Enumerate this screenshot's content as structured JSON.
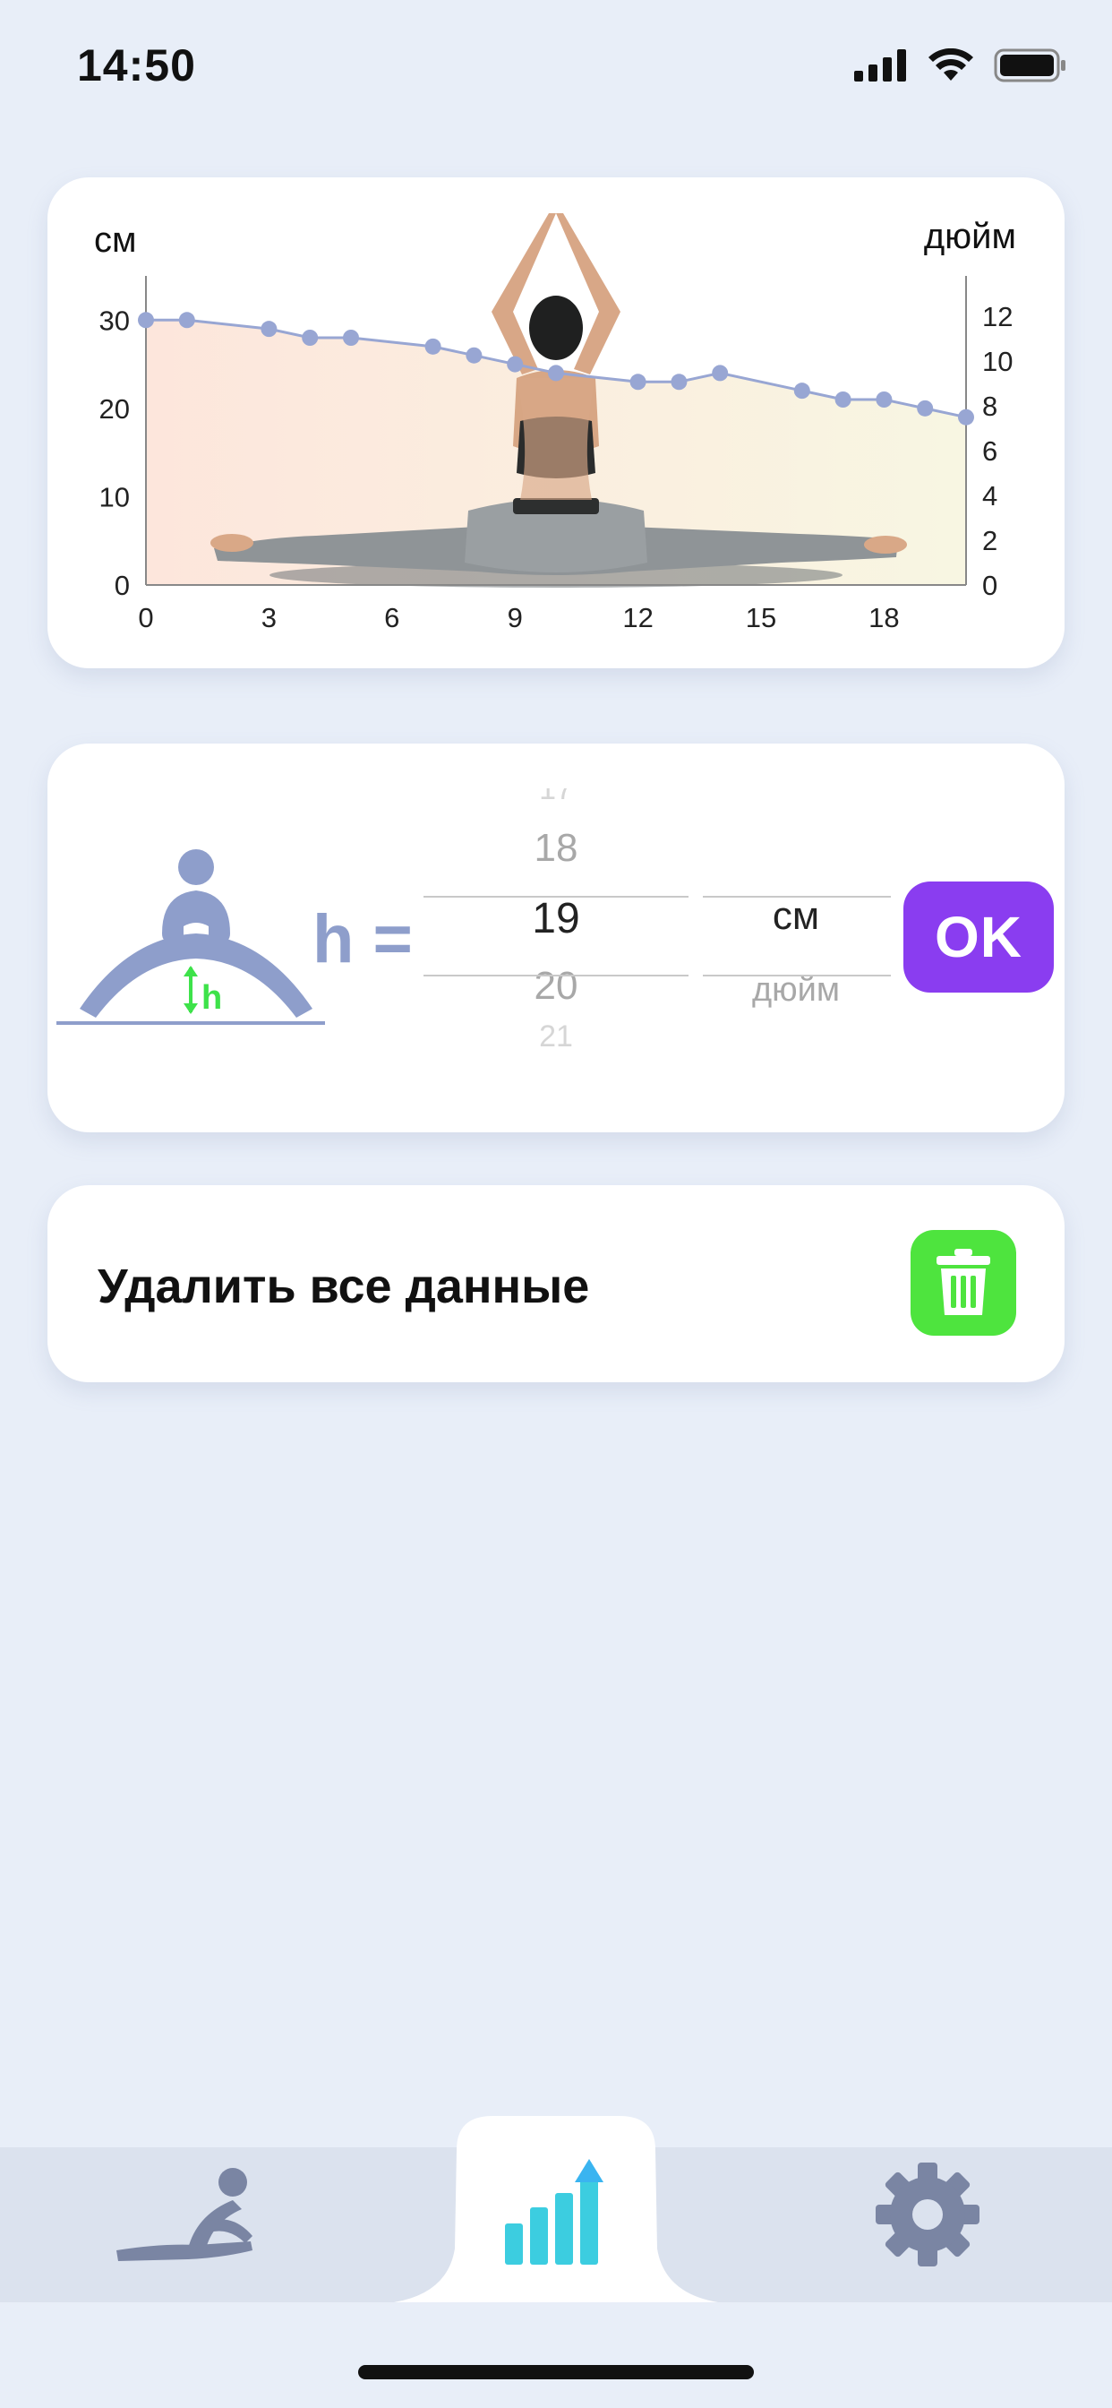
{
  "status_bar": {
    "time": "14:50"
  },
  "chart_card": {
    "left_unit": "см",
    "right_unit": "дюйм",
    "left_ticks": [
      "0",
      "10",
      "20",
      "30"
    ],
    "right_ticks": [
      "0",
      "2",
      "4",
      "6",
      "8",
      "10",
      "12"
    ],
    "x_ticks": [
      "0",
      "3",
      "6",
      "9",
      "12",
      "15",
      "18"
    ],
    "colors": {
      "line": "#98a6d3",
      "fill_top": "#fde9de",
      "fill_bottom": "#f5f7e8"
    }
  },
  "chart_data": {
    "type": "line",
    "xlabel": "",
    "ylabel": "см",
    "y2label": "дюйм",
    "xlim": [
      0,
      20
    ],
    "ylim": [
      0,
      35
    ],
    "y2lim": [
      0,
      13.8
    ],
    "x": [
      0,
      1,
      3,
      4,
      5,
      7,
      8,
      9,
      10,
      12,
      13,
      14,
      16,
      17,
      18,
      19,
      20
    ],
    "series": [
      {
        "values": [
          30,
          30,
          29,
          28,
          28,
          27,
          26,
          25,
          24,
          23,
          23,
          24,
          22,
          21,
          21,
          20,
          19
        ]
      }
    ]
  },
  "input_card": {
    "h_label": "h =",
    "picker_values": [
      "17",
      "18",
      "19",
      "20",
      "21"
    ],
    "selected_value": "19",
    "units": [
      "см",
      "дюйм"
    ],
    "selected_unit": "см",
    "ok_label": "OK",
    "icon_h_letter": "h"
  },
  "delete_card": {
    "label": "Удалить все данные"
  },
  "tabbar": {
    "tabs": [
      "stretch-pose-icon",
      "stats-chart-icon",
      "gear-icon"
    ],
    "active_index": 1
  }
}
